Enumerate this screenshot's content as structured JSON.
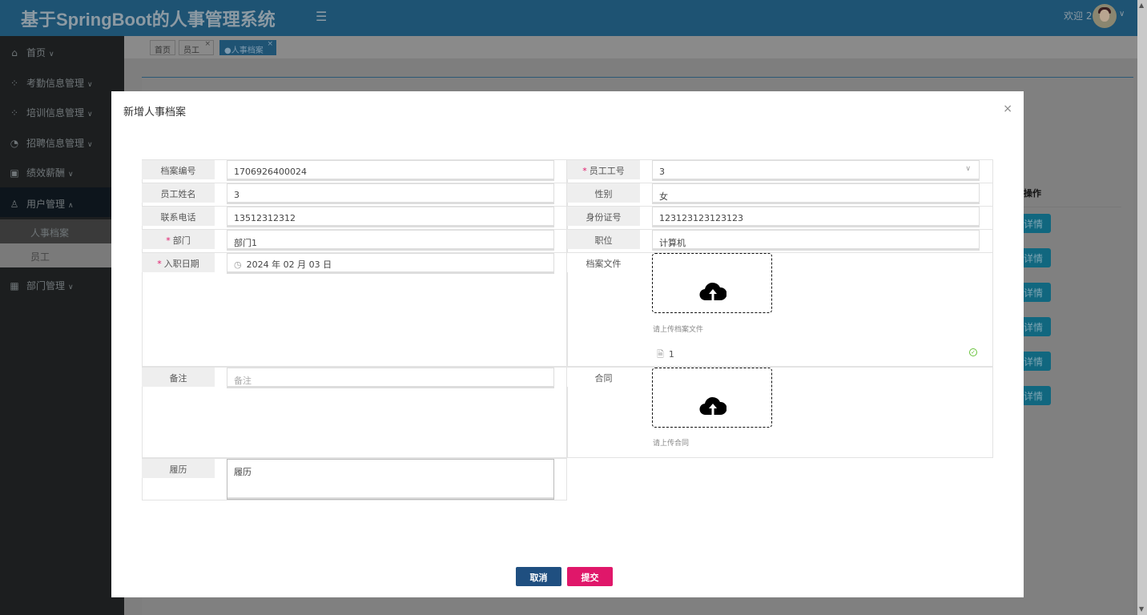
{
  "header": {
    "title": "基于SpringBoot的人事管理系统",
    "welcome": "欢迎 2"
  },
  "sidebar": {
    "items": [
      {
        "label": "首页"
      },
      {
        "label": "考勤信息管理"
      },
      {
        "label": "培训信息管理"
      },
      {
        "label": "招聘信息管理"
      },
      {
        "label": "绩效薪酬"
      },
      {
        "label": "用户管理"
      },
      {
        "label": "部门管理"
      }
    ],
    "sub_items": [
      {
        "label": "人事档案"
      },
      {
        "label": "员工"
      }
    ]
  },
  "tabs": [
    {
      "label": "首页"
    },
    {
      "label": "员工"
    },
    {
      "label": "●人事档案"
    }
  ],
  "background_table": {
    "op_header": "操作",
    "detail_label": "详情"
  },
  "modal": {
    "title": "新增人事档案",
    "fields": {
      "archive_no": {
        "label": "档案编号",
        "value": "1706926400024"
      },
      "employee_no": {
        "label": "员工工号",
        "value": "3"
      },
      "employee_name": {
        "label": "员工姓名",
        "value": "3"
      },
      "gender": {
        "label": "性别",
        "value": "女"
      },
      "phone": {
        "label": "联系电话",
        "value": "13512312312"
      },
      "id_card": {
        "label": "身份证号",
        "value": "123123123123123"
      },
      "department": {
        "label": "部门",
        "value": "部门1"
      },
      "position": {
        "label": "职位",
        "value": "计算机"
      },
      "hire_date": {
        "label": "入职日期",
        "value": "2024 年 02 月 03 日"
      },
      "archive_file": {
        "label": "档案文件",
        "hint": "请上传档案文件",
        "file_name": "1"
      },
      "remark": {
        "label": "备注",
        "placeholder": "备注"
      },
      "contract": {
        "label": "合同",
        "hint": "请上传合同"
      },
      "resume": {
        "label": "履历",
        "value": "履历"
      }
    },
    "cancel_label": "取消",
    "submit_label": "提交"
  },
  "colors": {
    "cancel": "#1f4f80",
    "submit": "#e0176a",
    "success": "#67c23a"
  }
}
